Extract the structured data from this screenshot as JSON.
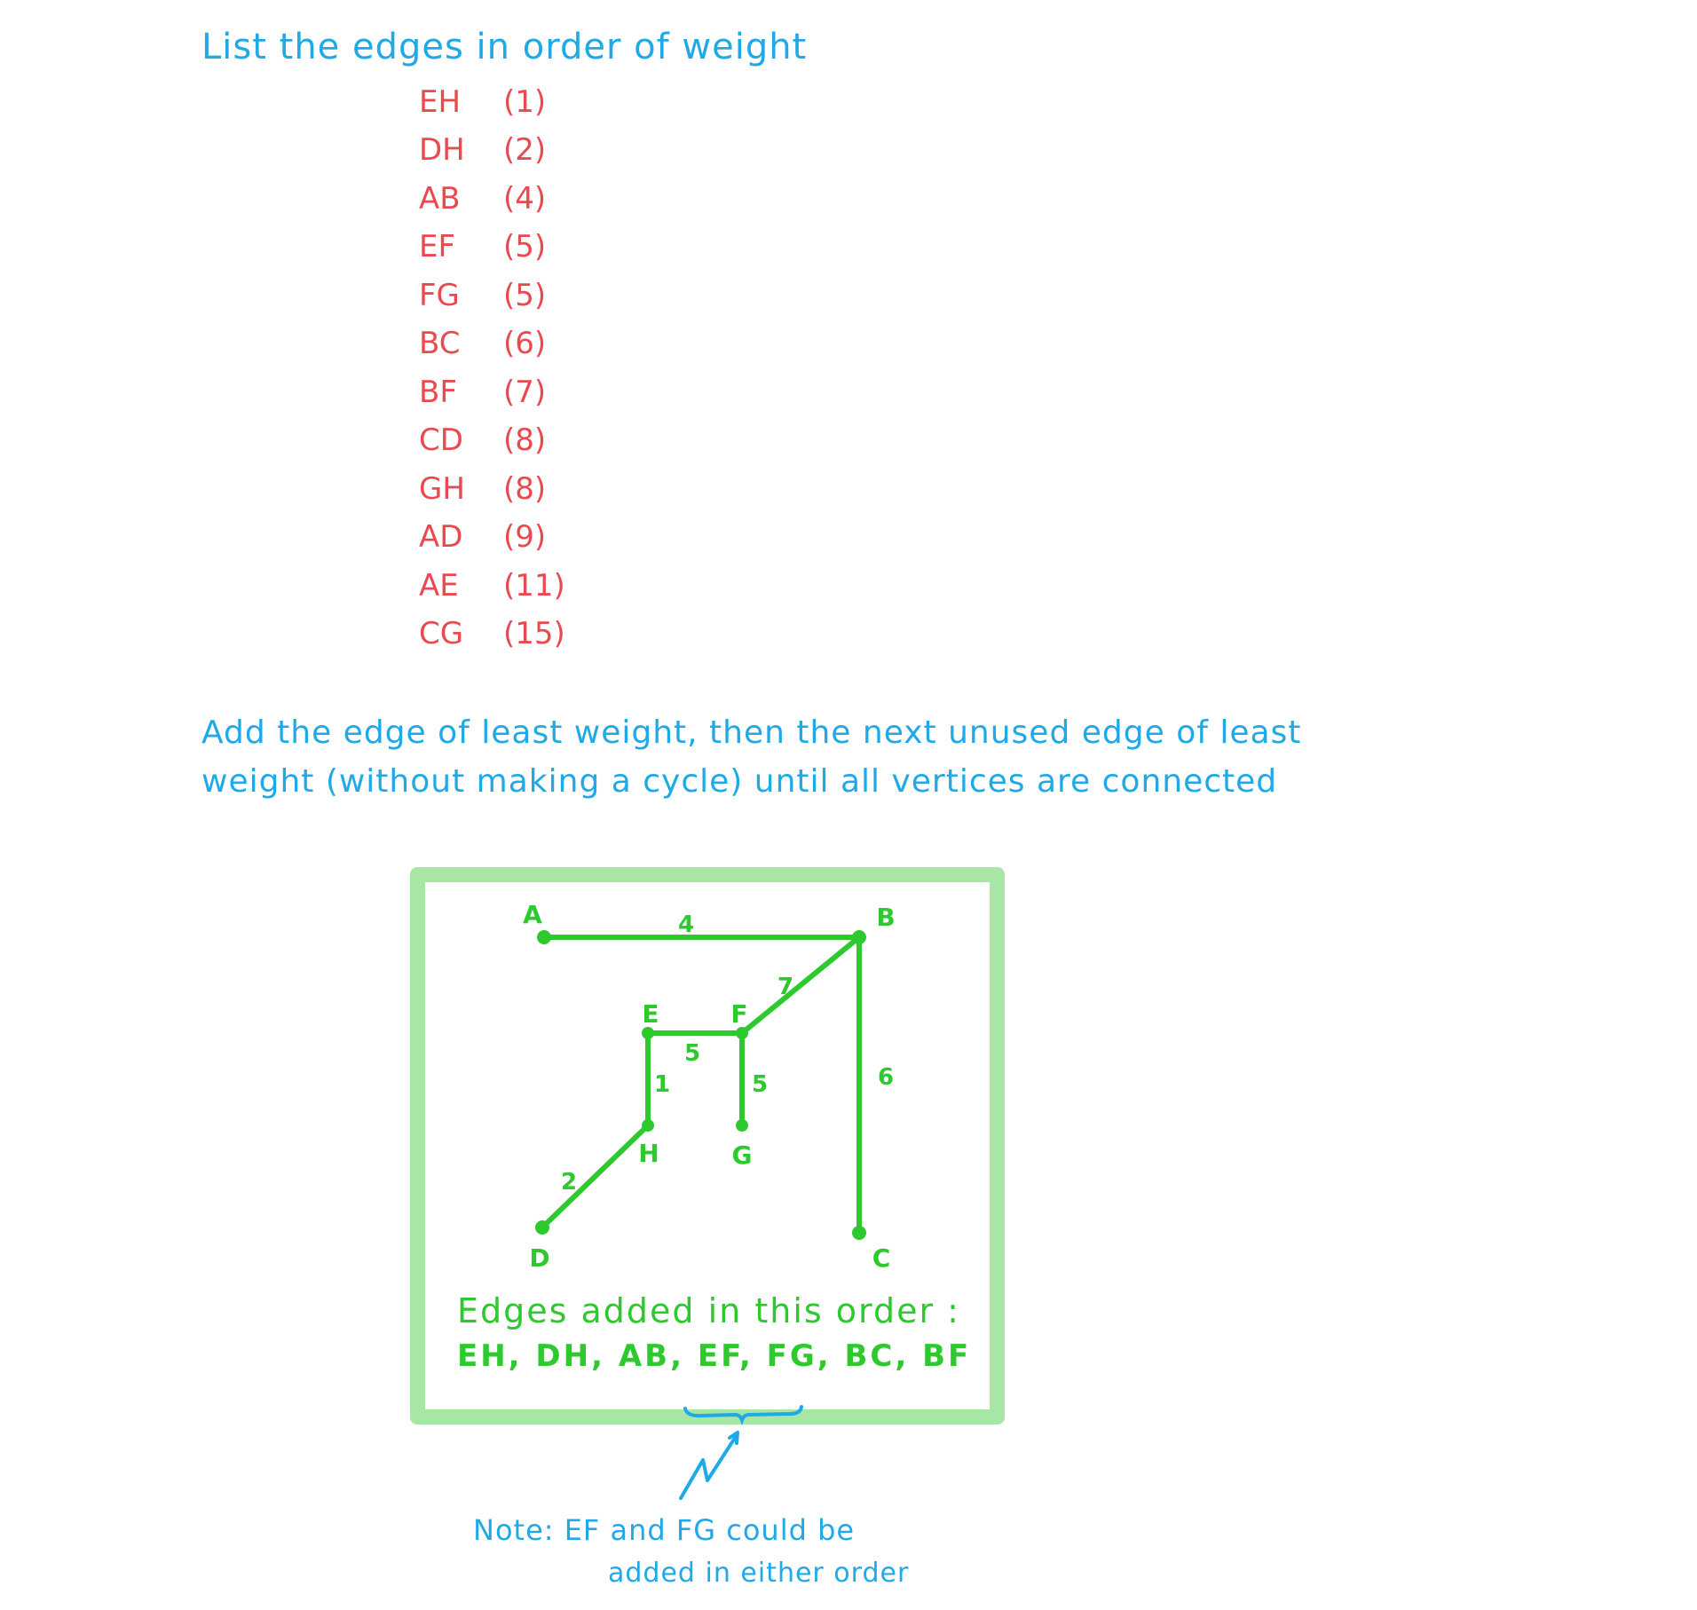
{
  "title": "List the edges in order of weight",
  "edges_sorted": [
    {
      "edge": "EH",
      "weight": "(1)"
    },
    {
      "edge": "DH",
      "weight": "(2)"
    },
    {
      "edge": "AB",
      "weight": "(4)"
    },
    {
      "edge": "EF",
      "weight": "(5)"
    },
    {
      "edge": "FG",
      "weight": "(5)"
    },
    {
      "edge": "BC",
      "weight": "(6)"
    },
    {
      "edge": "BF",
      "weight": "(7)"
    },
    {
      "edge": "CD",
      "weight": "(8)"
    },
    {
      "edge": "GH",
      "weight": "(8)"
    },
    {
      "edge": "AD",
      "weight": "(9)"
    },
    {
      "edge": "AE",
      "weight": "(11)"
    },
    {
      "edge": "CG",
      "weight": "(15)"
    }
  ],
  "instruction": {
    "line1": "Add the edge of least weight, then the next unused edge of least",
    "line2": "weight (without making a cycle) until all vertices are connected"
  },
  "graph": {
    "vertices": [
      "A",
      "B",
      "C",
      "D",
      "E",
      "F",
      "G",
      "H"
    ],
    "edges": [
      {
        "from": "A",
        "to": "B",
        "weight": "4"
      },
      {
        "from": "B",
        "to": "F",
        "weight": "7"
      },
      {
        "from": "B",
        "to": "C",
        "weight": "6"
      },
      {
        "from": "E",
        "to": "F",
        "weight": "5"
      },
      {
        "from": "F",
        "to": "G",
        "weight": "5"
      },
      {
        "from": "E",
        "to": "H",
        "weight": "1"
      },
      {
        "from": "D",
        "to": "H",
        "weight": "2"
      }
    ]
  },
  "order": {
    "heading": "Edges added in this order :",
    "list": "EH, DH, AB, EF, FG, BC, BF"
  },
  "note": {
    "line1": "Note: EF and FG could be",
    "line2": "added in either order"
  },
  "colors": {
    "heading": "#1fa9e6",
    "list": "#e84a50",
    "graph": "#2ec92e",
    "box_border": "#a8e6a6"
  }
}
